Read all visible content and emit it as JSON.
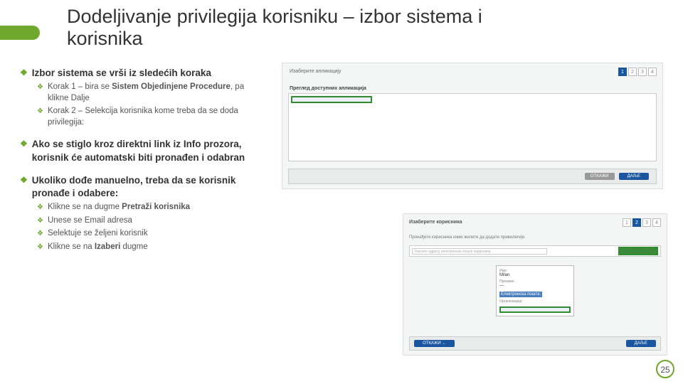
{
  "title": "Dodeljivanje privilegija korisniku – izbor sistema i korisnika",
  "bullets": {
    "b1": "Izbor sistema se vrši iz sledećih koraka",
    "b1a_pre": "Korak 1 – bira se ",
    "b1a_bold": "Sistem Objedinjene Procedure",
    "b1a_post": ", pa klikne Dalje",
    "b1b": "Korak 2 – Selekcija korisnika kome treba da se doda privilegija:",
    "b2": "Ako se stiglo kroz direktni link iz Info prozora, korisnik će automatski biti pronađen i odabran",
    "b3": "Ukoliko dođe manuelno, treba da se korisnik pronađe i odabere:",
    "b3a_pre": "Klikne se na dugme ",
    "b3a_bold": "Pretraži korisnika",
    "b3b": "Unese se Email adresa",
    "b3c": "Selektuje se željeni korisnik",
    "b3d_pre": "Klikne se na ",
    "b3d_bold": "Izaberi",
    "b3d_post": " dugme"
  },
  "panelA": {
    "header": "Изаберите апликацију",
    "sublabel": "Преглед доступних апликација",
    "steps": [
      "1",
      "2",
      "3",
      "4"
    ],
    "activeStep": 0,
    "btn_back": "ОТКАЖИ",
    "btn_next": "ДАЉЕ"
  },
  "panelB": {
    "header": "Изаберите корисника",
    "sub": "Пронађите корисника коме желите да додате привилегије.",
    "search_placeholder": "Унесите адресу електронске поште корисника",
    "steps": [
      "1",
      "2",
      "3",
      "4"
    ],
    "activeStep": 1,
    "card": {
      "name_label": "Име:",
      "name_value": "Milan",
      "surname_label": "Презиме:",
      "surname_value": "—",
      "email_label": "Електронска пошта:",
      "org_label": "Организација:"
    },
    "btn_back": "ОТКАЖИ ←",
    "btn_next": "ДАЉЕ"
  },
  "page": "25"
}
